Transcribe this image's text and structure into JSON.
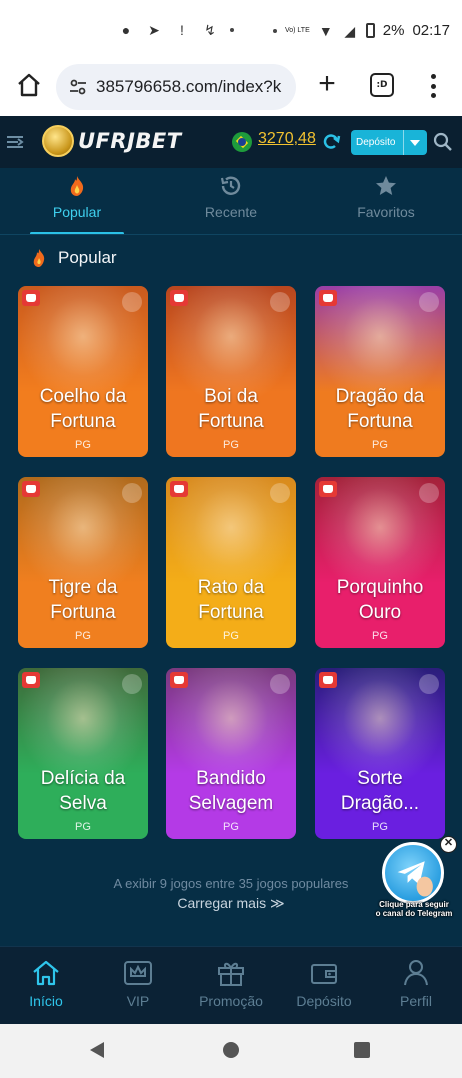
{
  "status_bar": {
    "time": "02:17",
    "battery": "2%",
    "network": "Vo) LTE"
  },
  "browser": {
    "url": "385796658.com/index?k",
    "tab_count": ":D"
  },
  "header": {
    "logo_text": "UFRJBET",
    "balance": "3270,48",
    "deposit_label": "Depósito"
  },
  "tabs": [
    {
      "label": "Popular",
      "icon": "fire-icon",
      "active": true
    },
    {
      "label": "Recente",
      "icon": "history-icon",
      "active": false
    },
    {
      "label": "Favoritos",
      "icon": "star-icon",
      "active": false
    }
  ],
  "section": {
    "title": "Popular",
    "icon": "fire-icon"
  },
  "games": [
    {
      "name_line1": "Coelho da",
      "name_line2": "Fortuna",
      "provider": "PG",
      "bg_top": "#c95a1e",
      "bg_bottom": "#f27d1e"
    },
    {
      "name_line1": "Boi da",
      "name_line2": "Fortuna",
      "provider": "PG",
      "bg_top": "#b8461f",
      "bg_bottom": "#ef7620"
    },
    {
      "name_line1": "Dragão da",
      "name_line2": "Fortuna",
      "provider": "PG",
      "bg_top": "#9a3fa6",
      "bg_bottom": "#ef7b1f"
    },
    {
      "name_line1": "Tigre da",
      "name_line2": "Fortuna",
      "provider": "PG",
      "bg_top": "#b06a1c",
      "bg_bottom": "#f07f1f"
    },
    {
      "name_line1": "Rato da",
      "name_line2": "Fortuna",
      "provider": "PG",
      "bg_top": "#d88a1e",
      "bg_bottom": "#f4ad18"
    },
    {
      "name_line1": "Porquinho",
      "name_line2": "Ouro",
      "provider": "PG",
      "bg_top": "#a3223a",
      "bg_bottom": "#e81f6b"
    },
    {
      "name_line1": "Delícia da",
      "name_line2": "Selva",
      "provider": "PG",
      "bg_top": "#3f6a3a",
      "bg_bottom": "#2eae5a"
    },
    {
      "name_line1": "Bandido",
      "name_line2": "Selvagem",
      "provider": "PG",
      "bg_top": "#7a3a7e",
      "bg_bottom": "#b43ae6"
    },
    {
      "name_line1": "Sorte",
      "name_line2": "Dragão...",
      "provider": "PG",
      "bg_top": "#2a1e7a",
      "bg_bottom": "#6a1fe0"
    }
  ],
  "load": {
    "info": "A exibir 9 jogos entre 35 jogos populares",
    "more": "Carregar mais"
  },
  "telegram": {
    "line1": "Clique para seguir",
    "line2": "o canal do Telegram"
  },
  "bottom_nav": [
    {
      "label": "Início",
      "icon": "home-icon",
      "active": true
    },
    {
      "label": "VIP",
      "icon": "vip-crown-icon",
      "active": false
    },
    {
      "label": "Promoção",
      "icon": "gift-icon",
      "active": false
    },
    {
      "label": "Depósito",
      "icon": "wallet-icon",
      "active": false
    },
    {
      "label": "Perfil",
      "icon": "profile-icon",
      "active": false
    }
  ],
  "colors": {
    "app_bg": "#062e45",
    "accent": "#2bc1e6",
    "balance": "#f2c230"
  }
}
